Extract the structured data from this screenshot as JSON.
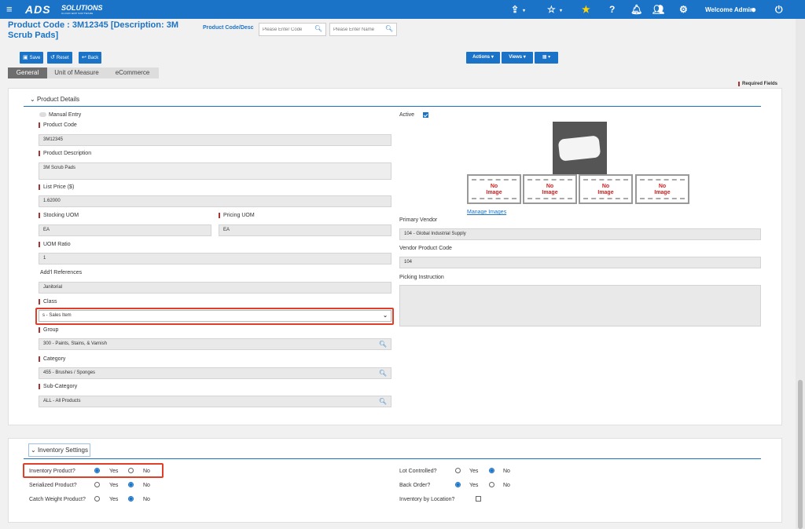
{
  "app": {
    "logo_main": "ADS",
    "logo_text": "SOLUTIONS",
    "logo_sub": "CLOUD ERP SOFTWARE",
    "welcome": "Welcome Admin"
  },
  "header": {
    "title_line1": "Product Code  : 3M12345 [Description: 3M",
    "title_line2": "Scrub Pads]",
    "search_label": "Product Code/Desc",
    "code_placeholder": "Please Enter Code",
    "name_placeholder": "Please Enter Name"
  },
  "toolbar": {
    "save": "Save",
    "reset": "Reset",
    "back": "Back",
    "actions": "Actions",
    "views": "Views"
  },
  "tabs": [
    {
      "label": "General",
      "active": true
    },
    {
      "label": "Unit of Measure",
      "active": false
    },
    {
      "label": "eCommerce",
      "active": false
    }
  ],
  "required_fields": "Required Fields",
  "product_details": {
    "title": "Product Details",
    "manual_entry": "Manual Entry",
    "active_label": "Active",
    "active": true,
    "product_code_label": "Product Code",
    "product_code": "3M12345",
    "product_description_label": "Product Description",
    "product_description": "3M Scrub Pads",
    "list_price_label": "List Price ($)",
    "list_price": "1.62000",
    "stocking_uom_label": "Stocking UOM",
    "stocking_uom": "EA",
    "pricing_uom_label": "Pricing UOM",
    "pricing_uom": "EA",
    "uom_ratio_label": "UOM Ratio",
    "uom_ratio": "1",
    "add_refs_label": "Add'l References",
    "add_refs": "Janitorial",
    "class_label": "Class",
    "class_value": "s - Sales Item",
    "group_label": "Group",
    "group_value": "300 - Paints, Stains, & Varnish",
    "category_label": "Category",
    "category_value": "455 - Brushes / Sponges",
    "subcategory_label": "Sub-Category",
    "subcategory_value": "ALL - All Products",
    "no_image_line1": "No",
    "no_image_line2": "Image",
    "manage_images": "Manage Images",
    "primary_vendor_label": "Primary Vendor",
    "primary_vendor": "104 - Global Industrial Supply",
    "vendor_product_code_label": "Vendor Product Code",
    "vendor_product_code": "104",
    "picking_instruction_label": "Picking Instruction",
    "picking_instruction": ""
  },
  "inventory": {
    "title": "Inventory Settings",
    "yes": "Yes",
    "no": "No",
    "inventory_product_label": "Inventory Product?",
    "inventory_product": "Yes",
    "serialized_label": "Serialized Product?",
    "serialized": "No",
    "catch_weight_label": "Catch Weight Product?",
    "catch_weight": "No",
    "lot_controlled_label": "Lot Controlled?",
    "lot_controlled": "No",
    "back_order_label": "Back Order?",
    "back_order": "Yes",
    "inv_by_location_label": "Inventory by Location?",
    "inv_by_location": false
  },
  "colors": {
    "accent": "#1a73c7",
    "highlight": "#e0402a",
    "required": "#aa3333"
  }
}
